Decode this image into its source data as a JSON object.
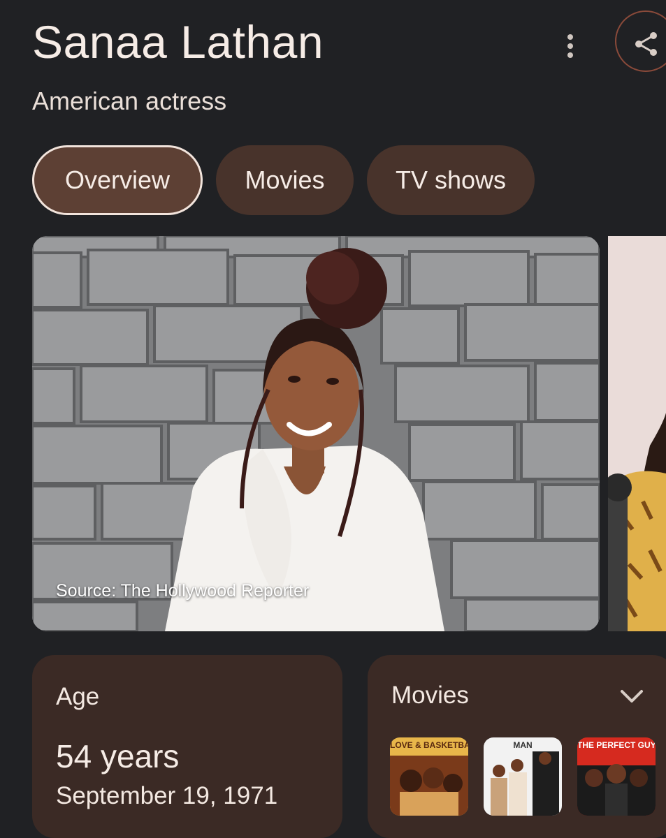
{
  "header": {
    "title": "Sanaa Lathan",
    "subtitle": "American actress"
  },
  "actions": {
    "more_icon": "more-vertical-icon",
    "share_icon": "share-icon"
  },
  "tabs": [
    {
      "label": "Overview",
      "active": true
    },
    {
      "label": "Movies",
      "active": false
    },
    {
      "label": "TV shows",
      "active": false
    }
  ],
  "image": {
    "source": "Source: The Hollywood Reporter"
  },
  "facts": {
    "age": {
      "label": "Age",
      "value": "54 years",
      "birthdate": "September 19, 1971"
    },
    "movies": {
      "label": "Movies",
      "expand_icon": "chevron-down-icon",
      "posters": [
        {
          "title_text": "LOVE & BASKETBALL",
          "accent": "#e8b64a"
        },
        {
          "title_text": "MAN",
          "accent": "#f2f2f2"
        },
        {
          "title_text": "THE PERFECT GUY",
          "accent": "#d62a1f"
        }
      ]
    }
  },
  "colors": {
    "background": "#202124",
    "chip": "#48332b",
    "chip_active": "#5d4034",
    "card": "#3b2a25",
    "share_ring": "#8a4a3a"
  }
}
